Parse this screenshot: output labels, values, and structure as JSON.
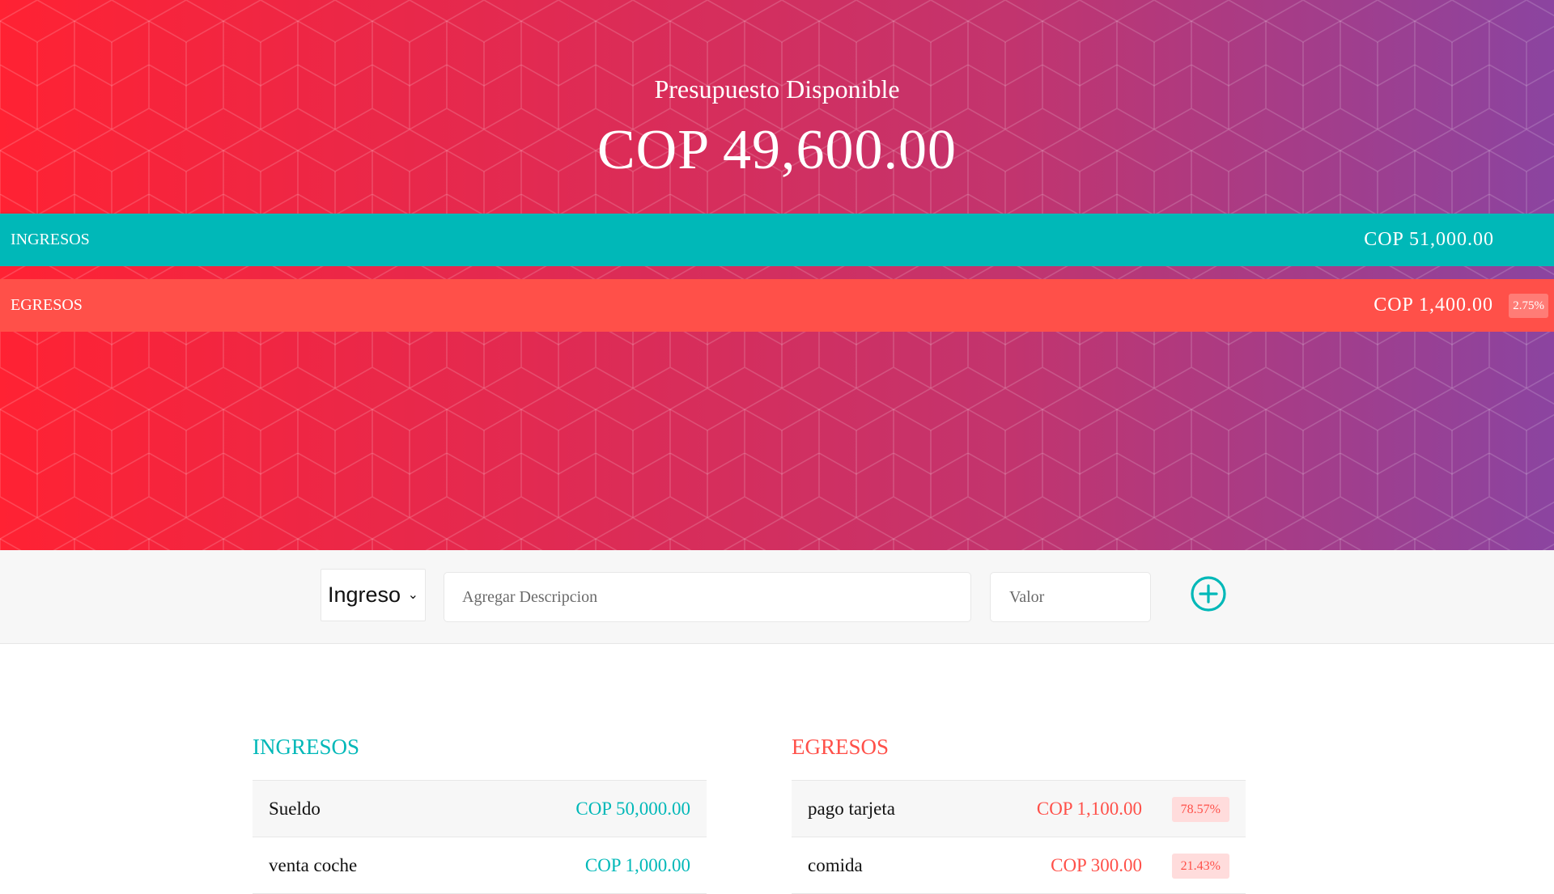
{
  "budget": {
    "title": "Presupuesto Disponible",
    "value": "COP 49,600.00"
  },
  "summary": {
    "income_label": "INGRESOS",
    "income_value": "COP 51,000.00",
    "expense_label": "EGRESOS",
    "expense_value": "COP 1,400.00",
    "expense_percentage": "2.75%"
  },
  "form": {
    "type_selected": "Ingreso",
    "description_placeholder": "Agregar Descripcion",
    "value_placeholder": "Valor",
    "add_icon": "plus-circle-icon"
  },
  "incomes": {
    "title": "INGRESOS",
    "items": [
      {
        "description": "Sueldo",
        "value": "COP 50,000.00"
      },
      {
        "description": "venta coche",
        "value": "COP 1,000.00"
      }
    ]
  },
  "expenses": {
    "title": "EGRESOS",
    "items": [
      {
        "description": "pago tarjeta",
        "value": "COP 1,100.00",
        "percentage": "78.57%"
      },
      {
        "description": "comida",
        "value": "COP 300.00",
        "percentage": "21.43%"
      }
    ]
  },
  "colors": {
    "income": "#00b8b8",
    "expense": "#ff5049",
    "gradient_start": "#ff2233",
    "gradient_end": "#8b44a0"
  }
}
